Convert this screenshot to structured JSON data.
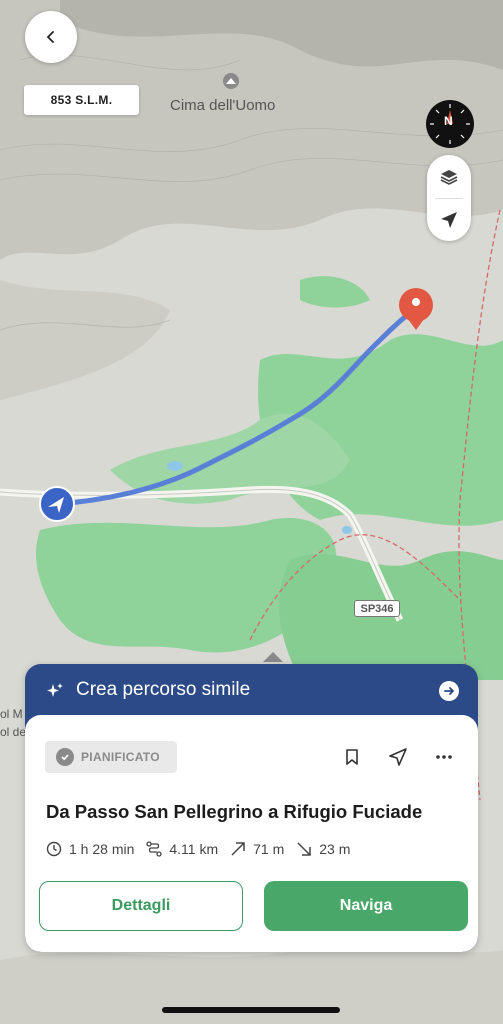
{
  "map": {
    "elevation": "853 S.L.M.",
    "peak_name": "Cima dell'Uomo",
    "road_badge": "SP346",
    "edge_labels": [
      "ol M",
      "ol de"
    ]
  },
  "compass": {
    "letter": "N"
  },
  "suggestion": {
    "label": "Crea percorso simile"
  },
  "route": {
    "status": "PIANIFICATO",
    "title": "Da Passo San Pellegrino a Rifugio Fuciade",
    "duration": "1 h 28 min",
    "distance": "4.11 km",
    "ascent": "71 m",
    "descent": "23 m"
  },
  "buttons": {
    "details": "Dettagli",
    "navigate": "Naviga"
  },
  "icons": {
    "back": "back-icon",
    "compass": "compass-icon",
    "layers": "layers-icon",
    "locate": "locate-icon",
    "bookmark": "bookmark-icon",
    "share": "share-icon",
    "more": "more-icon",
    "clock": "clock-icon",
    "distance": "distance-icon",
    "ascent": "ascent-icon",
    "descent": "descent-icon",
    "sparkle": "sparkle-icon"
  },
  "colors": {
    "route": "#5a7fd6",
    "start_marker": "#3b64c7",
    "end_marker": "#e35843",
    "banner": "#2c4a87",
    "primary_green": "#49a769",
    "forest": "#7cc98a"
  }
}
